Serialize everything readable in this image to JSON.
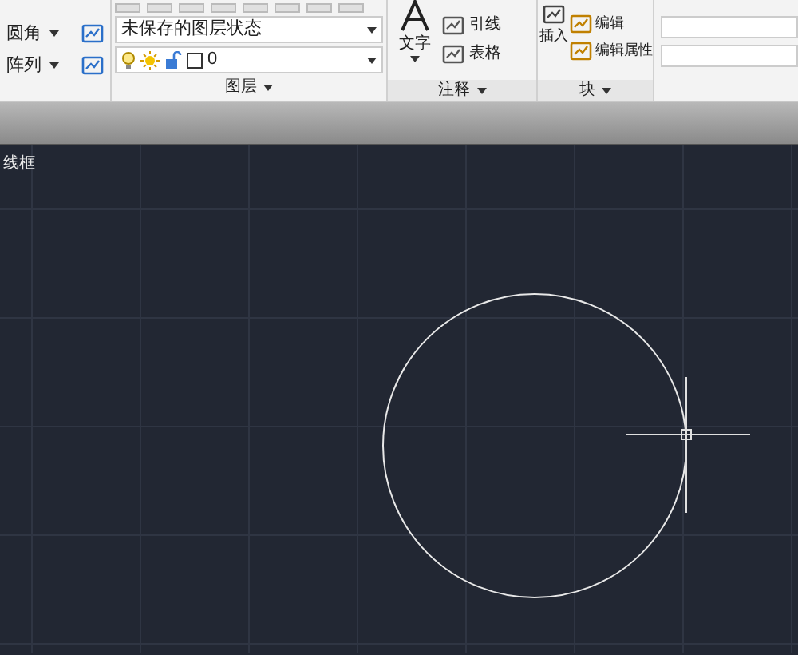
{
  "modify_panel": {
    "items": [
      {
        "label": "圆角"
      },
      {
        "label": "阵列"
      }
    ]
  },
  "layers_panel": {
    "title": "图层",
    "state_dropdown": "未保存的图层状态",
    "layer_dropdown": "0"
  },
  "annotation_panel": {
    "title": "注释",
    "big_button": "文字",
    "items": [
      "引线",
      "表格"
    ]
  },
  "block_panel": {
    "title": "块",
    "big_button": "插入",
    "items": [
      "编辑",
      "编辑属性"
    ]
  },
  "viewport": {
    "label": "线框"
  }
}
